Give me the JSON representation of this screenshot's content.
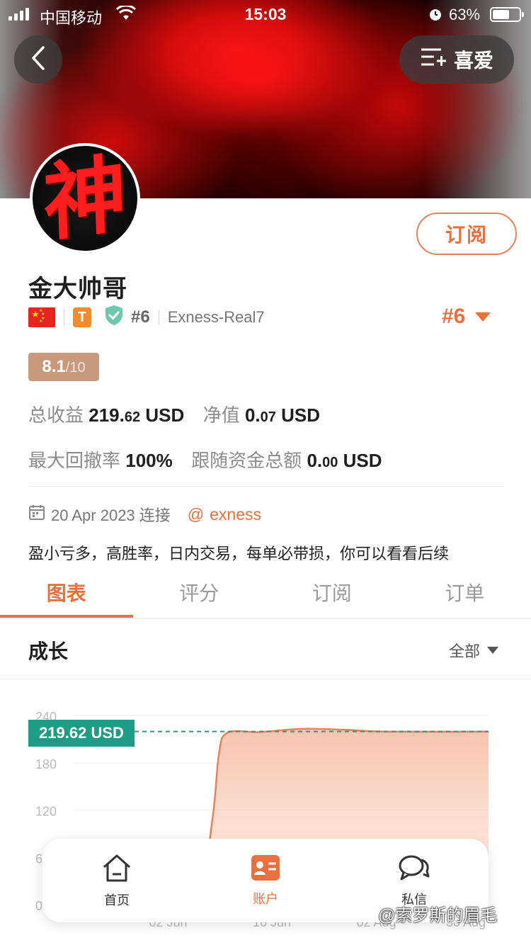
{
  "status_bar": {
    "carrier": "中国移动",
    "time": "15:03",
    "battery": "63%",
    "battery_level": 0.63
  },
  "header": {
    "favorite_label": "喜爱",
    "icons": [
      "chevron-left-icon",
      "list-add-icon"
    ]
  },
  "avatar": {
    "glyph": "神"
  },
  "profile": {
    "subscribe_label": "订阅",
    "username": "金大帅哥",
    "tier_badge": "T",
    "rank_small": "#6",
    "broker": "Exness-Real7",
    "rank_big": "#6",
    "score_main": "8.1",
    "score_denominator": "/10"
  },
  "stats": {
    "total_profit_label": "总收益",
    "total_profit_int": "219.",
    "total_profit_dec": "62",
    "total_profit_unit": "USD",
    "equity_label": "净值",
    "equity_int": "0.",
    "equity_dec": "07",
    "equity_unit": "USD",
    "max_drawdown_label": "最大回撤率",
    "max_drawdown_value": "100%",
    "follow_funds_label": "跟随资金总额",
    "follow_funds_int": "0.",
    "follow_funds_dec": "00",
    "follow_funds_unit": "USD"
  },
  "join": {
    "date": "20 Apr 2023 连接",
    "broker_tag": "exness"
  },
  "bio": "盈小亏多，高胜率，日内交易，每单必带损，你可以看看后续",
  "tabs": [
    {
      "label": "图表",
      "active": true
    },
    {
      "label": "评分",
      "active": false
    },
    {
      "label": "订阅",
      "active": false
    },
    {
      "label": "订单",
      "active": false
    }
  ],
  "chart_section": {
    "title": "成长",
    "filter_label": "全部"
  },
  "chart_data": {
    "type": "area",
    "current_value_label": "219.62 USD",
    "current_value": 219.62,
    "y_ticks": [
      "240",
      "180",
      "120",
      "60",
      "0"
    ],
    "ylim": [
      0,
      240
    ],
    "x_ticks": [
      "02 Jun",
      "16 Jun",
      "02 Aug",
      "30 Aug"
    ],
    "series": [
      {
        "x": [
          0,
          0.12,
          0.22,
          0.3,
          0.335,
          0.35,
          0.37,
          0.45,
          0.55,
          0.65,
          0.75,
          1.0
        ],
        "y": [
          0,
          0,
          0,
          10,
          110,
          190,
          218,
          219,
          223,
          222,
          219.6,
          219.62
        ]
      }
    ],
    "grid": true,
    "color": "#e8835a"
  },
  "bottom_nav": [
    {
      "label": "首页",
      "icon": "home-icon",
      "active": false
    },
    {
      "label": "账户",
      "icon": "account-card-icon",
      "active": true
    },
    {
      "label": "私信",
      "icon": "chat-bubbles-icon",
      "active": false
    }
  ],
  "watermark": "@索罗斯的眉毛",
  "colors": {
    "accent": "#e8703f",
    "teal": "#1e9c86",
    "score_bg": "#c79a7d"
  }
}
